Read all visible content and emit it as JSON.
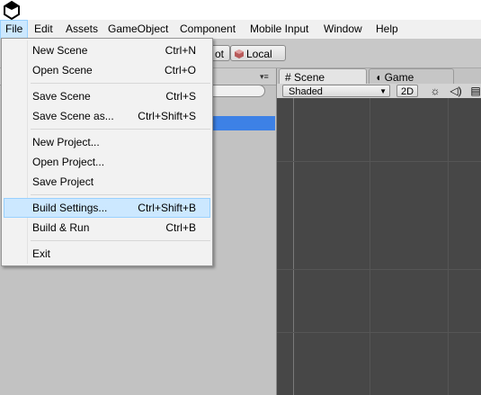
{
  "menubar": {
    "items": [
      "File",
      "Edit",
      "Assets",
      "GameObject",
      "Component",
      "Mobile Input",
      "Window",
      "Help"
    ],
    "active": "File"
  },
  "toolbar": {
    "pivot_partial": "ot",
    "local_label": "Local"
  },
  "scene_panel": {
    "tabs": [
      {
        "label": "Scene",
        "icon": "grid-icon",
        "active": true
      },
      {
        "label": "Game",
        "icon": "pacman-icon",
        "active": false
      }
    ],
    "shading_mode": "Shaded",
    "mode_2d": "2D"
  },
  "file_menu": {
    "items": [
      {
        "label": "New Scene",
        "shortcut": "Ctrl+N"
      },
      {
        "label": "Open Scene",
        "shortcut": "Ctrl+O"
      },
      {
        "label": "Save Scene",
        "shortcut": "Ctrl+S"
      },
      {
        "label": "Save Scene as...",
        "shortcut": "Ctrl+Shift+S"
      },
      {
        "label": "New Project...",
        "shortcut": ""
      },
      {
        "label": "Open Project...",
        "shortcut": ""
      },
      {
        "label": "Save Project",
        "shortcut": ""
      },
      {
        "label": "Build Settings...",
        "shortcut": "Ctrl+Shift+B",
        "highlighted": true
      },
      {
        "label": "Build & Run",
        "shortcut": "Ctrl+B"
      },
      {
        "label": "Exit",
        "shortcut": ""
      }
    ]
  },
  "colors": {
    "menu_highlight": "#cce8ff",
    "selection": "#3d81e6",
    "viewport_bg": "#474747"
  }
}
